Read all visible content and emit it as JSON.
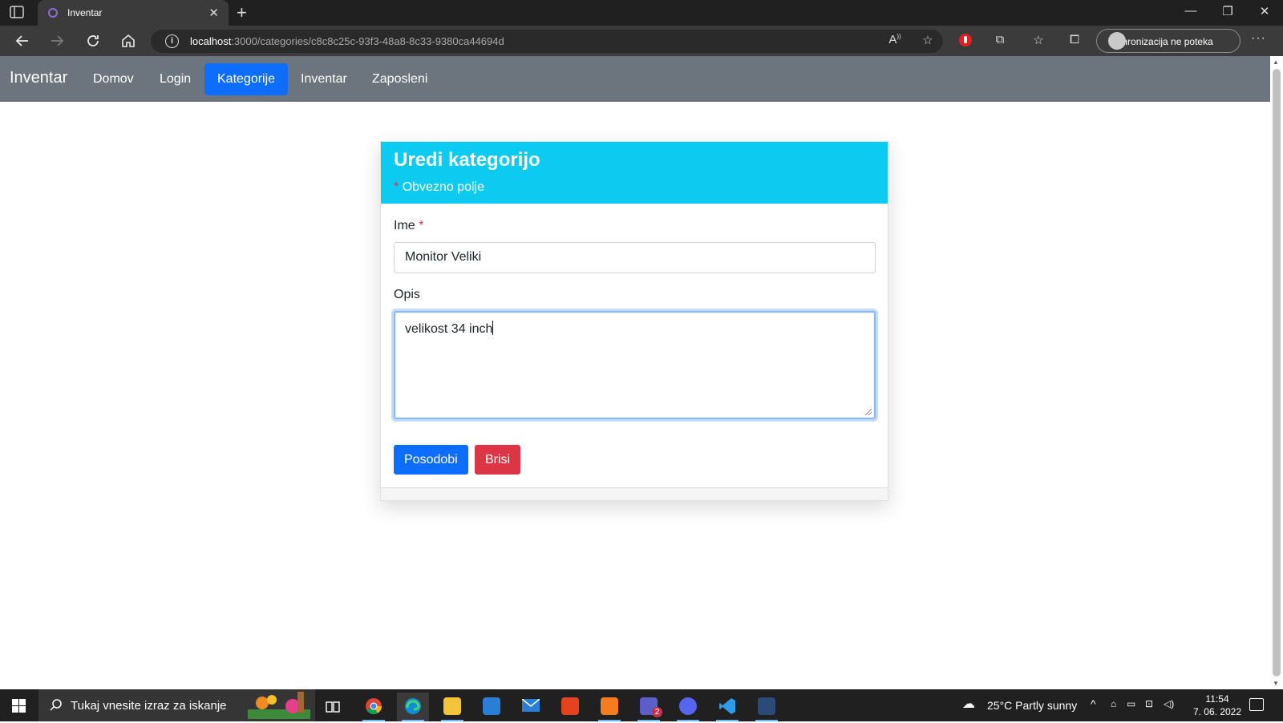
{
  "browser": {
    "tab_title": "Inventar",
    "url_host": "localhost",
    "url_rest": ":3000/categories/c8c8c25c-93f3-48a8-8c33-9380ca44694d",
    "sync_label": "Sinhronizacija ne poteka"
  },
  "nav": {
    "brand": "Inventar",
    "links": [
      "Domov",
      "Login",
      "Kategorije",
      "Inventar",
      "Zaposleni"
    ],
    "active": "Kategorije"
  },
  "form": {
    "title": "Uredi kategorijo",
    "required_mark": "*",
    "required_note": "Obvezno polje",
    "name_label": "Ime",
    "name_value": "Monitor Veliki",
    "description_label": "Opis",
    "description_value": "velikost 34 inch",
    "update_button": "Posodobi",
    "delete_button": "Brisi"
  },
  "taskbar": {
    "search_placeholder": "Tukaj vnesite izraz za iskanje",
    "weather": "25°C  Partly sunny",
    "time": "11:54",
    "date": "7. 06. 2022",
    "teams_badge": "2"
  },
  "colors": {
    "navbar": "#6c757d",
    "active_link": "#0d6efd",
    "card_header": "#0dcaf0",
    "primary": "#0d6efd",
    "danger": "#dc3545"
  }
}
